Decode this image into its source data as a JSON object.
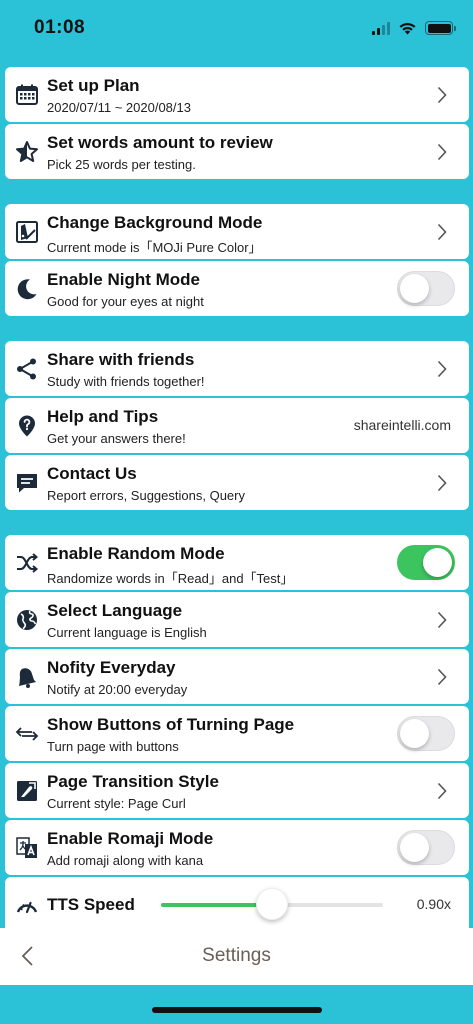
{
  "status": {
    "time": "01:08"
  },
  "rows": {
    "plan": {
      "title": "Set up Plan",
      "subtitle": "2020/07/11 ~ 2020/08/13",
      "icon": "calendar-icon"
    },
    "words": {
      "title": "Set words amount to review",
      "subtitle": "Pick 25 words per testing.",
      "icon": "star-icon"
    },
    "background": {
      "title": "Change Background Mode",
      "subtitle": "Current mode is「MOJi Pure Color」",
      "icon": "palette-icon"
    },
    "night": {
      "title": "Enable Night Mode",
      "subtitle": "Good for your eyes at night",
      "icon": "moon-icon",
      "enabled": false
    },
    "share": {
      "title": "Share with friends",
      "subtitle": "Study with friends together!",
      "icon": "share-icon"
    },
    "help": {
      "title": "Help and Tips",
      "subtitle": "Get your answers there!",
      "icon": "location-question-icon",
      "side_text": "shareintelli.com"
    },
    "contact": {
      "title": "Contact Us",
      "subtitle": "Report errors, Suggestions, Query",
      "icon": "message-icon"
    },
    "random": {
      "title": "Enable Random Mode",
      "subtitle": "Randomize words in「Read」and「Test」",
      "icon": "shuffle-icon",
      "enabled": true
    },
    "language": {
      "title": "Select Language",
      "subtitle": "Current language is English",
      "icon": "globe-icon"
    },
    "notify": {
      "title": "Nofity Everyday",
      "subtitle": "Notify at 20:00 everyday",
      "icon": "bell-icon"
    },
    "buttons": {
      "title": "Show Buttons of Turning Page",
      "subtitle": "Turn page with buttons",
      "icon": "swap-arrows-icon",
      "enabled": false
    },
    "transition": {
      "title": "Page Transition Style",
      "subtitle": "Current style: Page Curl",
      "icon": "page-curl-icon"
    },
    "romaji": {
      "title": "Enable Romaji Mode",
      "subtitle": "Add romaji along with kana",
      "icon": "translate-icon",
      "enabled": false
    },
    "tts": {
      "title": "TTS Speed",
      "value_label": "0.90x",
      "fraction": 0.5,
      "icon": "speedometer-icon"
    }
  },
  "nav": {
    "title": "Settings"
  },
  "colors": {
    "background": "#2bc2d8",
    "toggle_on": "#3cc55f",
    "nav_title": "#6b5e55"
  }
}
